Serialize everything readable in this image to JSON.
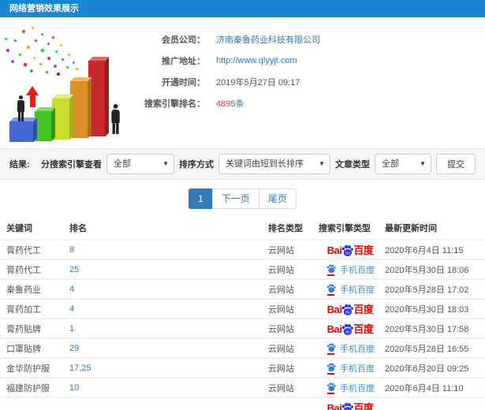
{
  "header": {
    "title": "网络营销效果展示"
  },
  "colors": {
    "header_bg": "#1987cf",
    "link": "#337ab7",
    "count_red": "#e4393c",
    "baidu_red": "#e10601",
    "baidu_blue": "#2932e1"
  },
  "info": {
    "rows": [
      {
        "label": "会员公司：",
        "value": "济南秦鲁药业科技有限公司"
      },
      {
        "label": "推广地址：",
        "value": "http://www.qlyyjt.com"
      },
      {
        "label": "开通时间：",
        "value": "2019年5月27日 09:17"
      },
      {
        "label": "搜索引擎排名：",
        "value": "4895",
        "suffix": "条"
      }
    ]
  },
  "filters": {
    "result_label": "结果:",
    "engine_label": "分搜索引擎查看",
    "engine_value": "全部",
    "sort_label": "排序方式",
    "sort_value": "关键词由短到长排序",
    "article_label": "文章类型",
    "article_value": "全部",
    "submit_label": "提交",
    "caret": "▼"
  },
  "pagination": {
    "current": "1",
    "next_label": "下一页",
    "last_label": "尾页"
  },
  "table": {
    "headers": [
      "关键词",
      "排名",
      "排名类型",
      "搜索引擎类型",
      "最新更新时间"
    ],
    "baidu_logo": {
      "bai": "Bai",
      "du": "du",
      "cn": "百度"
    },
    "mobile_label": "手机百度",
    "rows": [
      {
        "keyword": "膏药代工",
        "rank": "8",
        "rank_type": "云网站",
        "engine": "baidu",
        "updated": "2020年6月4日 11:15"
      },
      {
        "keyword": "膏药代工",
        "rank": "25",
        "rank_type": "云网站",
        "engine": "mobile",
        "updated": "2020年5月30日 18:06"
      },
      {
        "keyword": "秦鲁药业",
        "rank": "4",
        "rank_type": "云网站",
        "engine": "mobile",
        "updated": "2020年5月28日 17:02"
      },
      {
        "keyword": "膏药加工",
        "rank": "4",
        "rank_type": "云网站",
        "engine": "baidu",
        "updated": "2020年5月30日 18:03"
      },
      {
        "keyword": "膏药贴牌",
        "rank": "1",
        "rank_type": "云网站",
        "engine": "baidu",
        "updated": "2020年5月30日 17:58"
      },
      {
        "keyword": "口罩贴牌",
        "rank": "29",
        "rank_type": "云网站",
        "engine": "mobile",
        "updated": "2020年5月28日 16:55"
      },
      {
        "keyword": "金华防护服",
        "rank": "17,25",
        "rank_type": "云网站",
        "engine": "mobile",
        "updated": "2020年6月20日 09:25"
      },
      {
        "keyword": "福建防护服",
        "rank": "10",
        "rank_type": "云网站",
        "engine": "mobile",
        "updated": "2020年6月4日 11:10"
      }
    ],
    "partial_row": {
      "engine": "baidu"
    }
  }
}
